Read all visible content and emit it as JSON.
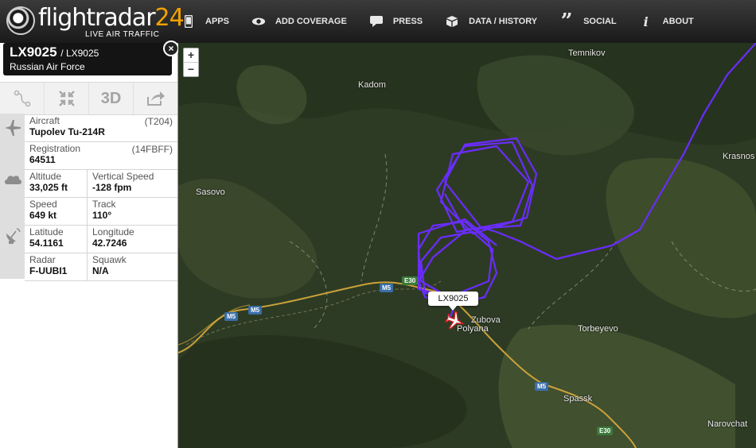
{
  "header": {
    "logo_text": "flightradar",
    "logo_number": "24",
    "logo_tagline": "LIVE AIR TRAFFIC",
    "nav": [
      {
        "label": "APPS",
        "icon": "phone-icon"
      },
      {
        "label": "ADD COVERAGE",
        "icon": "eye-icon"
      },
      {
        "label": "PRESS",
        "icon": "speech-bubble-icon"
      },
      {
        "label": "DATA / HISTORY",
        "icon": "box-icon"
      },
      {
        "label": "SOCIAL",
        "icon": "quote-icon"
      },
      {
        "label": "ABOUT",
        "icon": "info-icon"
      }
    ]
  },
  "flight": {
    "callsign": "LX9025",
    "callsign_sub": "/ LX9025",
    "airline": "Russian Air Force",
    "close_label": "×"
  },
  "toolbar": {
    "route_icon": "route-icon",
    "fit_icon": "collapse-icon",
    "threed_label": "3D",
    "share_icon": "share-icon"
  },
  "details": {
    "aircraft_label": "Aircraft",
    "aircraft_code": "(T204)",
    "aircraft_value": "Tupolev Tu-214R",
    "registration_label": "Registration",
    "registration_code": "(14FBFF)",
    "registration_value": "64511",
    "altitude_label": "Altitude",
    "altitude_value": "33,025 ft",
    "vspeed_label": "Vertical Speed",
    "vspeed_value": "-128 fpm",
    "speed_label": "Speed",
    "speed_value": "649 kt",
    "track_label": "Track",
    "track_value": "110°",
    "latitude_label": "Latitude",
    "latitude_value": "54.1161",
    "longitude_label": "Longitude",
    "longitude_value": "42.7246",
    "radar_label": "Radar",
    "radar_value": "F-UUBI1",
    "squawk_label": "Squawk",
    "squawk_value": "N/A"
  },
  "map": {
    "zoom_in": "+",
    "zoom_out": "−",
    "towns": {
      "temnikov": "Temnikov",
      "kadom": "Kadom",
      "krasnoslobodsk": "Krasnos",
      "sasovo": "Sasovo",
      "zubova_polyana_1": "Zubova",
      "zubova_polyana_2": "Polyana",
      "torbeyevo": "Torbeyevo",
      "spassk": "Spassk",
      "narovchat": "Narovchat"
    },
    "roads": {
      "m5_a": "M5",
      "m5_b": "M5",
      "m5_c": "M5",
      "m5_d": "M5",
      "e30_a": "E30",
      "e30_b": "E30"
    },
    "flight_label": "LX9025",
    "track_color": "#6a2cff"
  }
}
